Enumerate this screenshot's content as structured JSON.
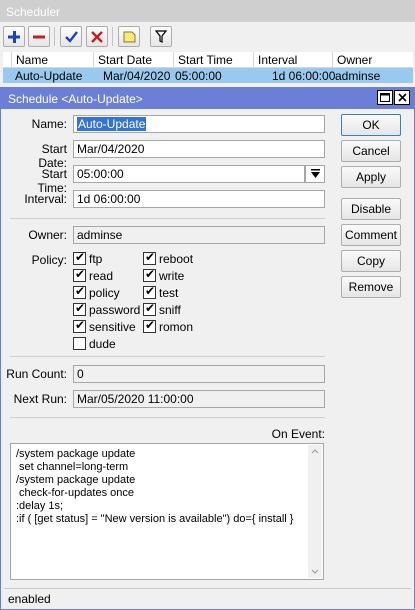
{
  "window": {
    "title": "Scheduler"
  },
  "toolbar": {
    "add_icon": "plus-icon",
    "remove_icon": "minus-icon",
    "enable_icon": "check-icon",
    "disable_icon": "x-icon",
    "comment_icon": "note-icon",
    "filter_icon": "filter-icon"
  },
  "table": {
    "columns": [
      "Name",
      "Start Date",
      "Start Time",
      "Interval",
      "Owner"
    ],
    "rows": [
      {
        "name": "Auto-Update",
        "start_date": "Mar/04/2020",
        "start_time": "05:00:00",
        "interval": "1d 06:00:00",
        "owner": "adminse"
      }
    ]
  },
  "dialog": {
    "title": "Schedule <Auto-Update>",
    "fields": {
      "name_label": "Name:",
      "name_value": "Auto-Update",
      "start_date_label": "Start Date:",
      "start_date_value": "Mar/04/2020",
      "start_time_label": "Start Time:",
      "start_time_value": "05:00:00",
      "interval_label": "Interval:",
      "interval_value": "1d 06:00:00",
      "owner_label": "Owner:",
      "owner_value": "adminse",
      "policy_label": "Policy:",
      "run_count_label": "Run Count:",
      "run_count_value": "0",
      "next_run_label": "Next Run:",
      "next_run_value": "Mar/05/2020 11:00:00",
      "on_event_label": "On Event:"
    },
    "policies": [
      {
        "label": "ftp",
        "checked": true
      },
      {
        "label": "reboot",
        "checked": true
      },
      {
        "label": "read",
        "checked": true
      },
      {
        "label": "write",
        "checked": true
      },
      {
        "label": "policy",
        "checked": true
      },
      {
        "label": "test",
        "checked": true
      },
      {
        "label": "password",
        "checked": true
      },
      {
        "label": "sniff",
        "checked": true
      },
      {
        "label": "sensitive",
        "checked": true
      },
      {
        "label": "romon",
        "checked": true
      },
      {
        "label": "dude",
        "checked": false
      }
    ],
    "on_event_lines": [
      "/system package update",
      " set channel=long-term",
      "/system package update",
      " check-for-updates once",
      ":delay 1s;",
      ":if ( [get status] = \"New version is available\") do={ install }"
    ],
    "buttons": {
      "ok": "OK",
      "cancel": "Cancel",
      "apply": "Apply",
      "disable": "Disable",
      "comment": "Comment",
      "copy": "Copy",
      "remove": "Remove"
    },
    "window_buttons": {
      "maximize": "maximize-icon",
      "close": "close-icon"
    },
    "status": "enabled"
  },
  "colors": {
    "accent": "#6b7fd7",
    "selection": "#99c9ef",
    "field_highlight": "#3373d9"
  }
}
